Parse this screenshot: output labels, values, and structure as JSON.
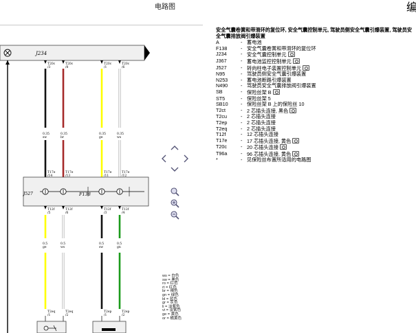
{
  "header": {
    "title": "电路图",
    "edit_label": "编"
  },
  "diagram": {
    "component_J234": "J234",
    "component_J527": "J527",
    "component_F138": "F138",
    "wires_top": [
      {
        "connector": "T20c",
        "pin": "/3",
        "size": "0.35",
        "color_code": "sw"
      },
      {
        "connector": "T20c",
        "pin": "/8",
        "size": "0.35",
        "color_code": "br"
      },
      {
        "connector": "T20c",
        "pin": "/1",
        "size": "0.35",
        "color_code": "ge"
      },
      {
        "connector": "T20c",
        "pin": "/6",
        "size": "0.35",
        "color_code": "ws"
      }
    ],
    "j527_top_pins": [
      {
        "connector": "T17e",
        "pin": "/14"
      },
      {
        "connector": "T17e",
        "pin": "/13"
      },
      {
        "connector": "T17e",
        "pin": "/11"
      },
      {
        "connector": "T17e",
        "pin": "/12"
      }
    ],
    "j527_bottom_pins": [
      {
        "connector": "T12f",
        "pin": "/5"
      },
      {
        "connector": "T12f",
        "pin": "/6"
      },
      {
        "connector": "T12f",
        "pin": "/3"
      },
      {
        "connector": "T12f",
        "pin": "/4"
      }
    ],
    "wires_bottom": [
      {
        "size": "0.5",
        "color_code": "ge"
      },
      {
        "size": "0.5",
        "color_code": "ws"
      },
      {
        "size": "0.5",
        "color_code": "sw"
      },
      {
        "size": "0.5",
        "color_code": "gn"
      }
    ],
    "end_connectors": [
      {
        "connector": "T2eq",
        "pin": "/1"
      },
      {
        "connector": "T2eq",
        "pin": "/2"
      },
      {
        "connector": "T2ep",
        "pin": "/1"
      },
      {
        "connector": "T2ep",
        "pin": "/2"
      }
    ],
    "colors": {
      "black": "#111111",
      "brown": "#a52a2a",
      "yellow": "#ffff00",
      "white": "#ffffff",
      "green": "#1a9a1a",
      "rail": "#000000"
    }
  },
  "legend": {
    "title": "安全气囊卷簧和带滑环的复位环, 安全气囊控制单元, 驾驶员侧安全气囊引爆装置, 驾驶员安全气囊排放阀引爆装置",
    "items": [
      {
        "code": "A",
        "desc": "蓄电池",
        "cam": false
      },
      {
        "code": "F138",
        "desc": "安全气囊卷簧和带滑环的复位环",
        "cam": false
      },
      {
        "code": "J234",
        "desc": "安全气囊控制单元",
        "cam": true
      },
      {
        "code": "J367",
        "desc": "蓄电池监控控制单元",
        "cam": true
      },
      {
        "code": "J527",
        "desc": "转向柱电子装置控制单元",
        "cam": true
      },
      {
        "code": "N95",
        "desc": "驾驶员侧安全气囊引爆装置",
        "cam": false
      },
      {
        "code": "N253",
        "desc": "蓄电池断路引爆装置",
        "cam": false
      },
      {
        "code": "N490",
        "desc": "驾驶员安全气囊排放阀引爆装置",
        "cam": false
      },
      {
        "code": "SB",
        "desc": "保险丝架 B",
        "cam": true
      },
      {
        "code": "ST5",
        "desc": "保险丝架 5",
        "cam": false
      },
      {
        "code": "SB10",
        "desc": "保险丝架 B 上的保险丝 10",
        "cam": false
      },
      {
        "code": "T2ct",
        "desc": "2 芯插头连接, 黑色",
        "cam": true
      },
      {
        "code": "T2cu",
        "desc": "2 芯插头连接",
        "cam": false
      },
      {
        "code": "T2ep",
        "desc": "2 芯插头连接",
        "cam": false
      },
      {
        "code": "T2eq",
        "desc": "2 芯插头连接",
        "cam": false
      },
      {
        "code": "T12f",
        "desc": "12 芯插头连接",
        "cam": false
      },
      {
        "code": "T17e",
        "desc": "17 芯插头连接, 黄色",
        "cam": true
      },
      {
        "code": "T20c",
        "desc": "20 芯插头连接",
        "cam": true
      },
      {
        "code": "T96a",
        "desc": "96 芯插头连接, 黄色",
        "cam": true
      },
      {
        "code": "*",
        "desc": "见保险丝布置所适用的电路图",
        "cam": false
      }
    ]
  },
  "color_key": [
    "ws = 白色",
    "sw = 黑色",
    "ro = 红色",
    "rt = 红色",
    "br = 褐色",
    "gn = 绿色",
    "bl = 蓝色",
    "gr = 灰色",
    "li = 淡紫色",
    "vi = 淡紫色",
    "ge = 黄色",
    "or = 橘黄色"
  ]
}
